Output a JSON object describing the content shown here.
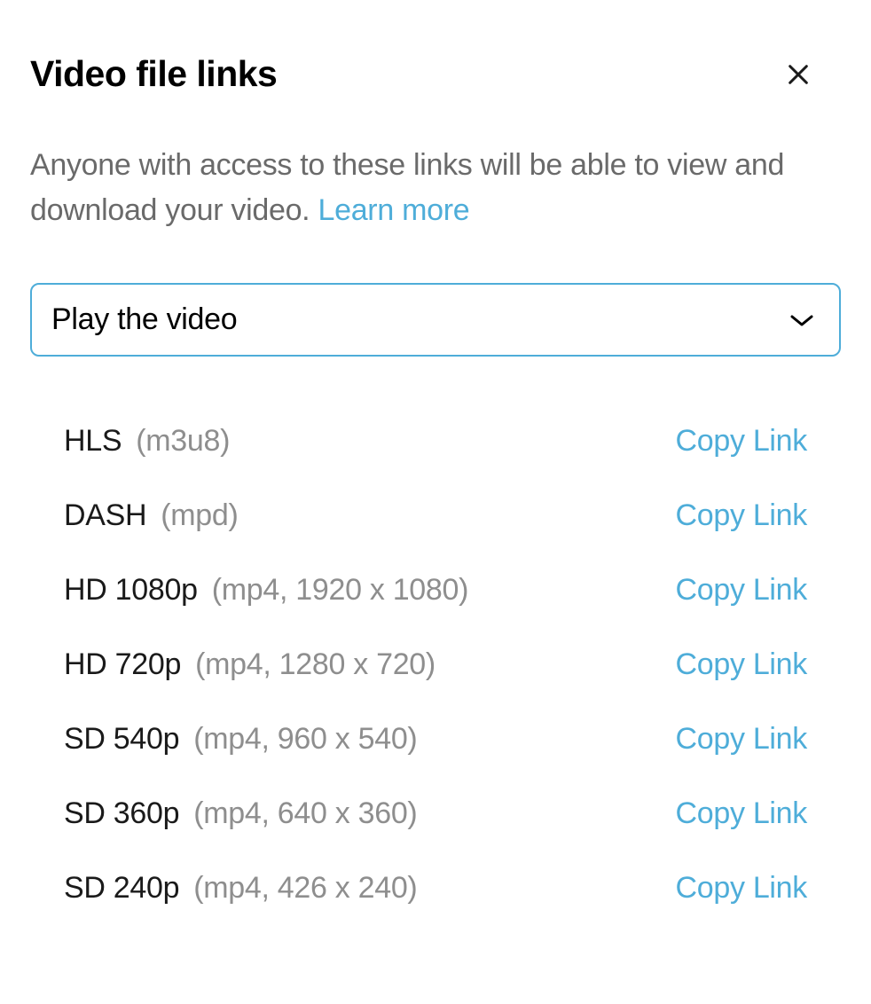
{
  "header": {
    "title": "Video file links"
  },
  "description": {
    "text": "Anyone with access to these links will be able to view and download your video. ",
    "learn_more": "Learn more"
  },
  "dropdown": {
    "selected": "Play the video"
  },
  "links": [
    {
      "name": "HLS",
      "format": "(m3u8)",
      "action": "Copy Link"
    },
    {
      "name": "DASH",
      "format": "(mpd)",
      "action": "Copy Link"
    },
    {
      "name": "HD 1080p",
      "format": "(mp4, 1920 x 1080)",
      "action": "Copy Link"
    },
    {
      "name": "HD 720p",
      "format": "(mp4, 1280 x 720)",
      "action": "Copy Link"
    },
    {
      "name": "SD 540p",
      "format": "(mp4, 960 x 540)",
      "action": "Copy Link"
    },
    {
      "name": "SD 360p",
      "format": "(mp4, 640 x 360)",
      "action": "Copy Link"
    },
    {
      "name": "SD 240p",
      "format": "(mp4, 426 x 240)",
      "action": "Copy Link"
    }
  ]
}
